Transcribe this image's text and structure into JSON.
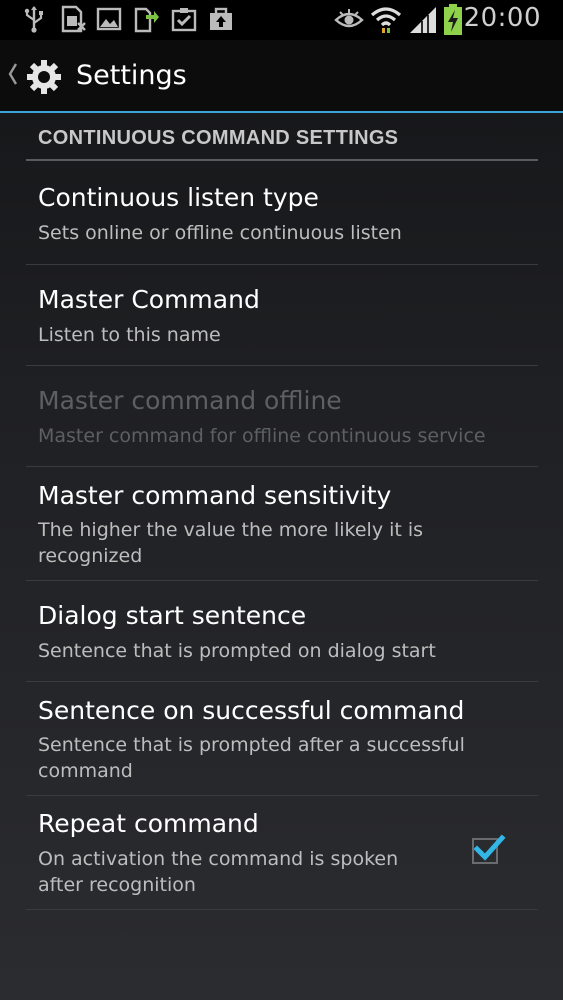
{
  "status_bar": {
    "time": "20:00",
    "icons": [
      "usb-icon",
      "sim-card-icon",
      "image-icon",
      "download-icon",
      "clipboard-check-icon",
      "briefcase-upload-icon",
      "eye-icon",
      "wifi-icon",
      "signal-icon",
      "battery-charging-icon"
    ]
  },
  "action_bar": {
    "title": "Settings",
    "accent_color": "#3aa6d8"
  },
  "settings": {
    "category": "CONTINUOUS COMMAND SETTINGS",
    "items": [
      {
        "title": "Continuous listen type",
        "summary": "Sets online or offline continuous listen",
        "enabled": true
      },
      {
        "title": "Master Command",
        "summary": "Listen to this name",
        "enabled": true
      },
      {
        "title": "Master command offline",
        "summary": "Master command for offline continuous service",
        "enabled": false
      },
      {
        "title": "Master command sensitivity",
        "summary": "The higher the value the more likely it is recognized",
        "enabled": true
      },
      {
        "title": "Dialog start sentence",
        "summary": "Sentence that is prompted on dialog start",
        "enabled": true
      },
      {
        "title": "Sentence on successful command",
        "summary": "Sentence that is prompted after a successful command",
        "enabled": true
      },
      {
        "title": "Repeat command",
        "summary": "On activation the command is spoken after recognition",
        "enabled": true,
        "checked": true
      }
    ]
  }
}
